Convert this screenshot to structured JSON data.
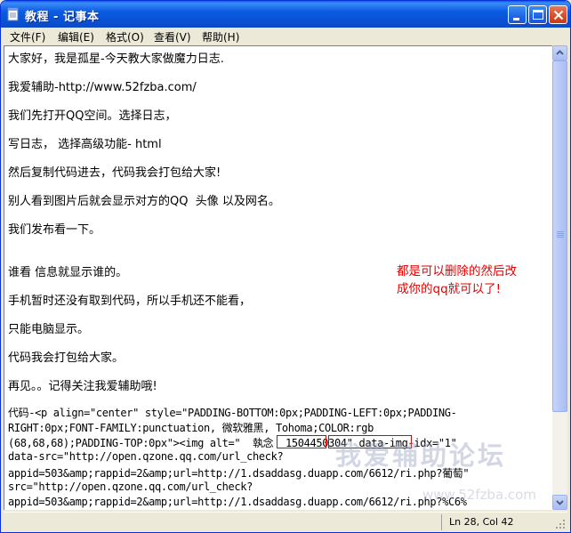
{
  "window": {
    "title": "教程 - 记事本"
  },
  "menu": {
    "items": [
      {
        "label": "文件(F)"
      },
      {
        "label": "编辑(E)"
      },
      {
        "label": "格式(O)"
      },
      {
        "label": "查看(V)"
      },
      {
        "label": "帮助(H)"
      }
    ]
  },
  "document": {
    "lines": [
      "大家好，我是孤星-今天教大家做魔力日志.",
      "我爱辅助-http://www.52fzba.com/",
      "我们先打开QQ空间。选择日志，",
      "写日志， 选择高级功能- html",
      "然后复制代码进去，代码我会打包给大家!",
      "别人看到图片后就会显示对方的QQ  头像 以及网名。",
      "我们发布看一下。",
      "谁看 信息就显示谁的。",
      "手机暂时还没有取到代码，所以手机还不能看，",
      "只能电脑显示。",
      "代码我会打包给大家。",
      "再见。。记得关注我爱辅助哦!"
    ],
    "code_lines": [
      "代码-<p align=\"center\" style=\"PADDING-BOTTOM:0px;PADDING-LEFT:0px;PADDING-",
      "RIGHT:0px;FONT-FAMILY:punctuation, 微软雅黑, Tohoma;COLOR:rgb",
      "(68,68,68);PADDING-TOP:0px\"><img alt=\"  執念  1504450304\" data-img-idx=\"1\"",
      "data-src=\"http://open.qzone.qq.com/url_check?",
      "appid=503&amp;rappid=2&amp;url=http://1.dsaddasg.duapp.com/6612/ri.php?葡萄\"",
      "src=\"http://open.qzone.qq.com/url_check?",
      "appid=503&amp;rappid=2&amp;url=http://1.dsaddasg.duapp.com/6612/ri.php?%C6%"
    ],
    "annotation": "都是可以删除的然后改\n成你的qq就可以了!",
    "watermark": "我爱辅助论坛",
    "watermark_url": "www.52fzba.com"
  },
  "status": {
    "position": "Ln 28, Col 42"
  },
  "colors": {
    "title_bar": "#0a5ee8",
    "annotation_red": "#e00000",
    "editor_bg": "#ffffff"
  }
}
